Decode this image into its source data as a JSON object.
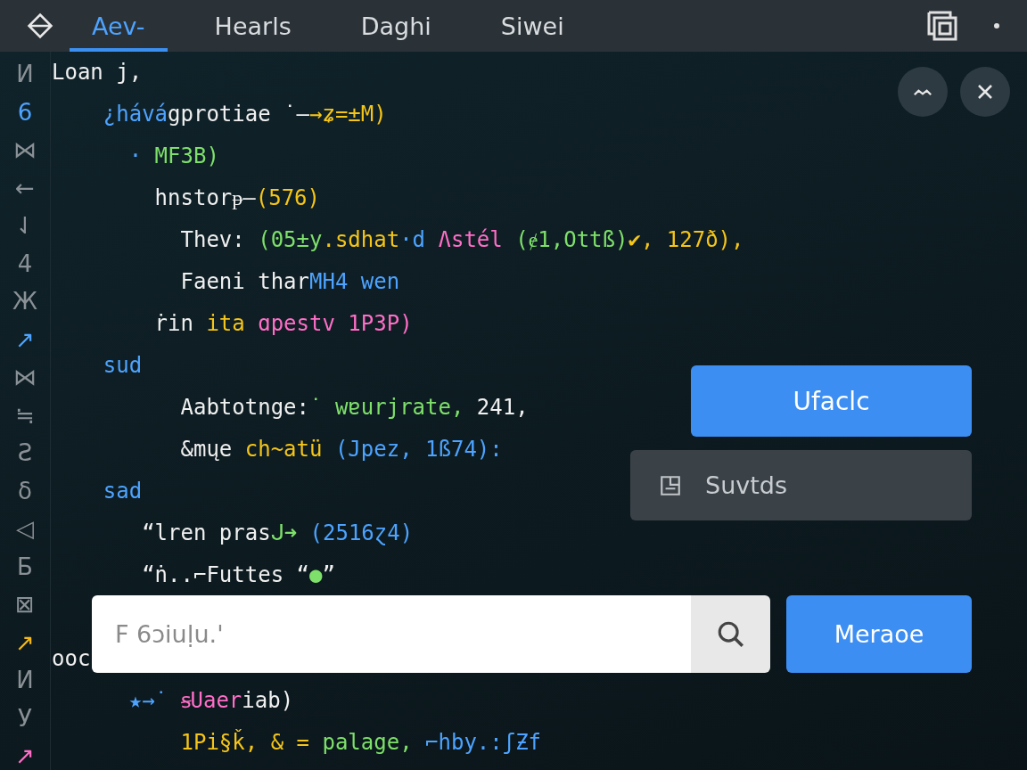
{
  "tabs": [
    {
      "label": "Aev-",
      "selected": true
    },
    {
      "label": "Hearls",
      "selected": false
    },
    {
      "label": "Daghi",
      "selected": false
    },
    {
      "label": "Siwei",
      "selected": false
    }
  ],
  "gutter": [
    {
      "text": "И",
      "color": "#8a9196"
    },
    {
      "text": "6",
      "color": "#4da3ff"
    },
    {
      "text": "⋈",
      "color": "#8a9196"
    },
    {
      "text": "←",
      "color": "#8a9196"
    },
    {
      "text": "⇃",
      "color": "#8a9196"
    },
    {
      "text": "4",
      "color": "#8a9196"
    },
    {
      "text": "Ж",
      "color": "#8a9196"
    },
    {
      "text": "↗",
      "color": "#4da3ff"
    },
    {
      "text": "⋈",
      "color": "#8a9196"
    },
    {
      "text": "≒",
      "color": "#8a9196"
    },
    {
      "text": "Ƨ",
      "color": "#8a9196"
    },
    {
      "text": "ẟ",
      "color": "#8a9196"
    },
    {
      "text": "◁",
      "color": "#8a9196"
    },
    {
      "text": "Ƃ",
      "color": "#8a9196"
    },
    {
      "text": "⊠",
      "color": "#8a9196"
    },
    {
      "text": "↗",
      "color": "#f5b818"
    },
    {
      "text": "И",
      "color": "#8a9196"
    },
    {
      "text": "У",
      "color": "#8a9196"
    },
    {
      "text": "↗",
      "color": "#ff6ec7"
    }
  ],
  "code_lines": [
    {
      "kind": "code",
      "segments": [
        {
          "text": "Loan j,",
          "color": "#f0f0f0"
        }
      ]
    },
    {
      "kind": "code",
      "segments": [
        {
          "text": "    ¿hává",
          "color": "#4da3ff"
        },
        {
          "text": "gprotiae ˙—",
          "color": "#f0f0f0"
        },
        {
          "text": "→ʑ=±M)",
          "color": "#f5c518"
        }
      ]
    },
    {
      "kind": "code",
      "segments": [
        {
          "text": "      · ",
          "color": "#4da3ff"
        },
        {
          "text": "MF3B)",
          "color": "#7ee06a"
        }
      ]
    },
    {
      "kind": "code",
      "segments": [
        {
          "text": "        hnstorᵽ—",
          "color": "#f0f0f0"
        },
        {
          "text": "(576)",
          "color": "#f5c518"
        }
      ]
    },
    {
      "kind": "code",
      "segments": [
        {
          "text": "          Thev:",
          "color": "#f0f0f0"
        },
        {
          "text": " (05±y",
          "color": "#7ee06a"
        },
        {
          "text": ".sdhat",
          "color": "#f5c518"
        },
        {
          "text": "·d",
          "color": "#4da3ff"
        },
        {
          "text": " Ʌstél",
          "color": "#ff6ec7"
        },
        {
          "text": " (ɇ1,Ottß)",
          "color": "#7ee06a"
        },
        {
          "text": "✔, 127ð),",
          "color": "#f5c518"
        }
      ]
    },
    {
      "kind": "code",
      "segments": [
        {
          "text": "          Faeni thar",
          "color": "#f0f0f0"
        },
        {
          "text": "MH4 wen",
          "color": "#4da3ff"
        }
      ]
    },
    {
      "kind": "code",
      "segments": [
        {
          "text": "        ṙin ",
          "color": "#f0f0f0"
        },
        {
          "text": "ita ",
          "color": "#f5c518"
        },
        {
          "text": "ɑpestv 1P3P)",
          "color": "#ff6ec7"
        }
      ]
    },
    {
      "kind": "code",
      "segments": [
        {
          "text": "    sud",
          "color": "#4da3ff"
        }
      ]
    },
    {
      "kind": "code",
      "segments": [
        {
          "text": "          Aabtotnge:",
          "color": "#f0f0f0"
        },
        {
          "text": "˙ wɐurjrate,",
          "color": "#7ee06a"
        },
        {
          "text": " 241,",
          "color": "#f0f0f0"
        }
      ]
    },
    {
      "kind": "code",
      "segments": [
        {
          "text": "          &mųe",
          "color": "#f0f0f0"
        },
        {
          "text": " ch~atü",
          "color": "#f5c518"
        },
        {
          "text": " (Jpez, 1ß74):",
          "color": "#4da3ff"
        }
      ]
    },
    {
      "kind": "code",
      "segments": [
        {
          "text": "    sad",
          "color": "#4da3ff"
        }
      ]
    },
    {
      "kind": "code",
      "segments": [
        {
          "text": "       “lren pras",
          "color": "#f0f0f0"
        },
        {
          "text": "ᒍ➜",
          "color": "#7ee06a"
        },
        {
          "text": " (2516ɀ4)",
          "color": "#4da3ff"
        }
      ]
    },
    {
      "kind": "code",
      "segments": [
        {
          "text": "       “ṅ..⌐Futtes “",
          "color": "#f0f0f0"
        },
        {
          "text": "●",
          "color": "#7ee06a"
        },
        {
          "text": "”",
          "color": "#f0f0f0"
        }
      ]
    },
    {
      "kind": "blank"
    },
    {
      "kind": "code",
      "segments": [
        {
          "text": "ooc",
          "color": "#f0f0f0"
        }
      ]
    },
    {
      "kind": "code",
      "segments": [
        {
          "text": "      ★→˙ ",
          "color": "#4da3ff"
        },
        {
          "text": "ꞩUaer",
          "color": "#ff6ec7"
        },
        {
          "text": "iab)",
          "color": "#f0f0f0"
        }
      ]
    },
    {
      "kind": "code",
      "segments": [
        {
          "text": "          1Pi§ǩ, & =",
          "color": "#f5c518"
        },
        {
          "text": " palage,",
          "color": "#7ee06a"
        },
        {
          "text": " ⌐hby.:ʃƵf",
          "color": "#4da3ff"
        }
      ]
    }
  ],
  "primary_button": "Ufaclc",
  "secondary_button": "Suvtds",
  "search": {
    "placeholder": "F 6ɔiuḷu.'"
  },
  "replace_button": "Meraoe"
}
